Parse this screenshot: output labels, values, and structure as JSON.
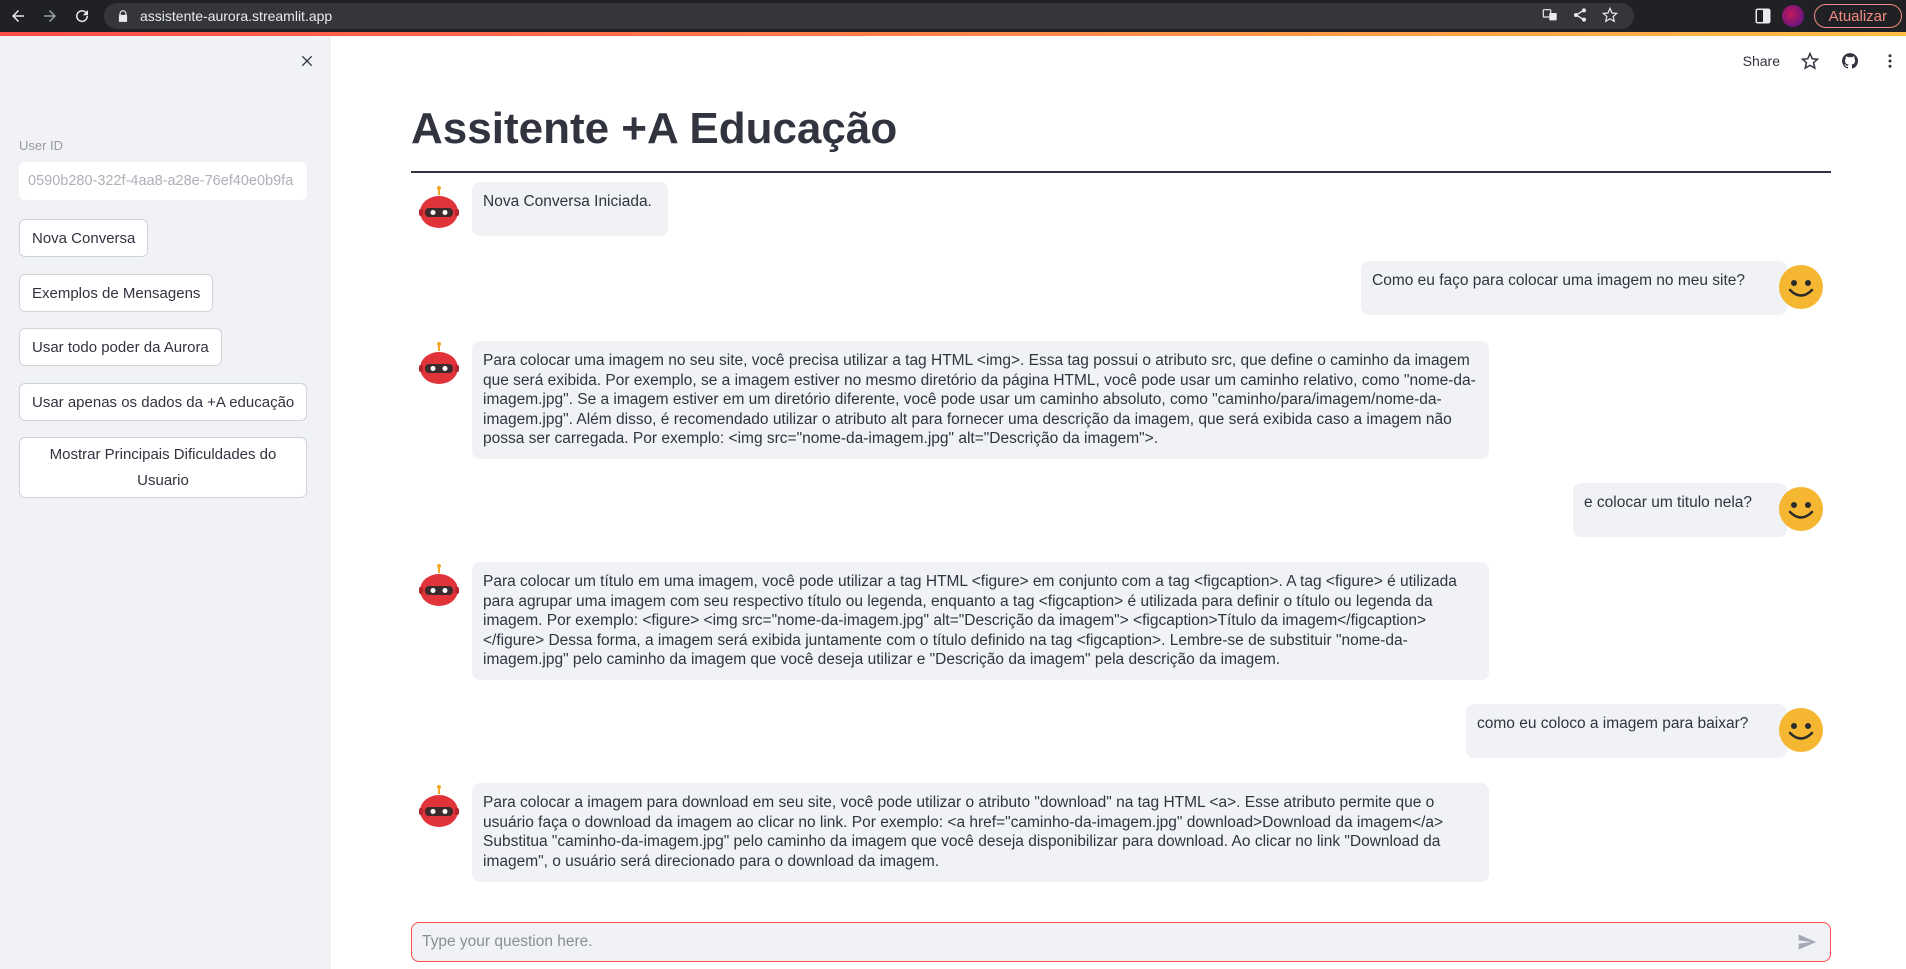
{
  "browser": {
    "url": "assistente-aurora.streamlit.app",
    "update_label": "Atualizar"
  },
  "sidebar": {
    "userid_label": "User ID",
    "userid_value": "0590b280-322f-4aa8-a28e-76ef40e0b9fa",
    "buttons": [
      "Nova Conversa",
      "Exemplos de Mensagens",
      "Usar todo poder da Aurora",
      "Usar apenas os dados da +A educação",
      "Mostrar Principais Dificuldades do Usuario"
    ]
  },
  "toolbar": {
    "share_label": "Share"
  },
  "main": {
    "title": "Assitente +A Educação"
  },
  "messages": [
    {
      "role": "assistant",
      "text": "Nova Conversa Iniciada."
    },
    {
      "role": "user",
      "text": "Como eu faço para colocar uma imagem no meu site?"
    },
    {
      "role": "assistant",
      "text": "Para colocar uma imagem no seu site, você precisa utilizar a tag HTML <img>. Essa tag possui o atributo src, que define o caminho da imagem que será exibida. Por exemplo, se a imagem estiver no mesmo diretório da página HTML, você pode usar um caminho relativo, como \"nome-da-imagem.jpg\". Se a imagem estiver em um diretório diferente, você pode usar um caminho absoluto, como \"caminho/para/imagem/nome-da-imagem.jpg\". Além disso, é recomendado utilizar o atributo alt para fornecer uma descrição da imagem, que será exibida caso a imagem não possa ser carregada. Por exemplo: <img src=\"nome-da-imagem.jpg\" alt=\"Descrição da imagem\">."
    },
    {
      "role": "user",
      "text": "e colocar um titulo nela?"
    },
    {
      "role": "assistant",
      "text": "Para colocar um título em uma imagem, você pode utilizar a tag HTML <figure> em conjunto com a tag <figcaption>. A tag <figure> é utilizada para agrupar uma imagem com seu respectivo título ou legenda, enquanto a tag <figcaption> é utilizada para definir o título ou legenda da imagem. Por exemplo: <figure> <img src=\"nome-da-imagem.jpg\" alt=\"Descrição da imagem\"> <figcaption>Título da imagem</figcaption> </figure> Dessa forma, a imagem será exibida juntamente com o título definido na tag <figcaption>. Lembre-se de substituir \"nome-da-imagem.jpg\" pelo caminho da imagem que você deseja utilizar e \"Descrição da imagem\" pela descrição da imagem."
    },
    {
      "role": "user",
      "text": "como eu coloco a imagem para baixar?"
    },
    {
      "role": "assistant",
      "text": "Para colocar a imagem para download em seu site, você pode utilizar o atributo \"download\" na tag HTML <a>. Esse atributo permite que o usuário faça o download da imagem ao clicar no link. Por exemplo: <a href=\"caminho-da-imagem.jpg\" download>Download da imagem</a> Substitua \"caminho-da-imagem.jpg\" pelo caminho da imagem que você deseja disponibilizar para download. Ao clicar no link \"Download da imagem\", o usuário será direcionado para o download da imagem."
    }
  ],
  "chat_input": {
    "placeholder": "Type your question here."
  },
  "icons": {
    "back": "arrow-left-icon",
    "forward": "arrow-right-icon",
    "reload": "reload-icon",
    "lock": "lock-icon",
    "translate": "translate-icon",
    "share": "share-icon",
    "bookmark": "star-icon",
    "side-panel": "side-panel-icon",
    "close": "close-icon",
    "github": "github-icon",
    "menu": "more-vert-icon",
    "send": "send-icon",
    "bot": "robot-avatar-icon",
    "user": "smiley-avatar-icon"
  },
  "colors": {
    "accent": "#ff4b4b",
    "sidebar_bg": "#f0f2f6",
    "bubble_bg": "#f0f2f6",
    "text": "#31333f"
  }
}
